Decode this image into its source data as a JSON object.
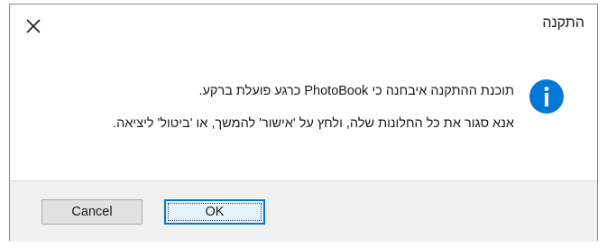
{
  "dialog": {
    "title": "התקנה",
    "close_icon": "close-icon",
    "info_icon": "info-icon",
    "accent_color": "#0078d7",
    "message_line1": "תוכנת ההתקנה איבחנה כי PhotoBook כרגע פועלת ברקע.",
    "message_line2": "אנא סגור את כל החלונות שלה, ולחץ על 'אישור' להמשך, או 'ביטול' ליציאה.",
    "buttons": {
      "ok_label": "OK",
      "cancel_label": "Cancel"
    }
  }
}
